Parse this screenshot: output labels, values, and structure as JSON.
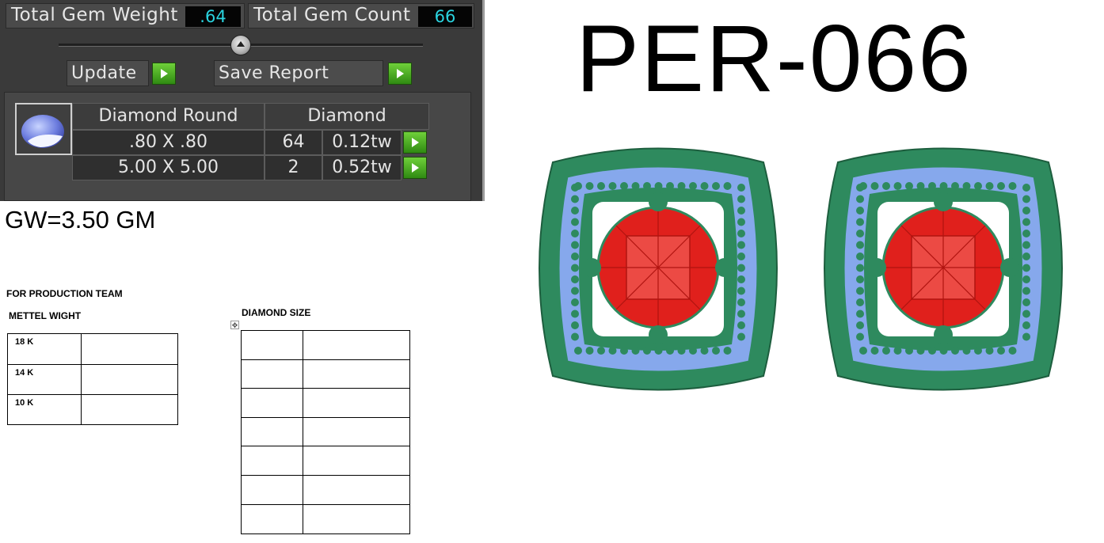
{
  "gem_panel": {
    "total_weight_label": "Total Gem Weight",
    "total_weight_value": ".64",
    "total_count_label": "Total Gem Count",
    "total_count_value": "66",
    "update_label": "Update",
    "save_report_label": "Save Report",
    "gem_thumbnail_icon": "oval-gem-icon",
    "gem_shape": "Diamond Round",
    "gem_material": "Diamond",
    "rows": [
      {
        "size": ".80 X .80",
        "count": "64",
        "weight": "0.12tw"
      },
      {
        "size": "5.00 X 5.00",
        "count": "2",
        "weight": "0.52tw"
      }
    ],
    "colors": {
      "panel": "#3a3a3a",
      "value_text": "#2ad4e0",
      "go_button": "#4fb726"
    }
  },
  "gw_text": "GW=3.50 GM",
  "production": {
    "title": "FOR PRODUCTION TEAM",
    "metal_title": "METTEL WIGHT",
    "metal_rows": [
      "18 K",
      "14 K",
      "10 K"
    ],
    "diamond_title": "DIAMOND SIZE"
  },
  "design_code": "PER-066",
  "image_colors": {
    "metal": "#2e8a5e",
    "center_stone": "#e0201c",
    "accent_stones": "#86a8ec"
  }
}
